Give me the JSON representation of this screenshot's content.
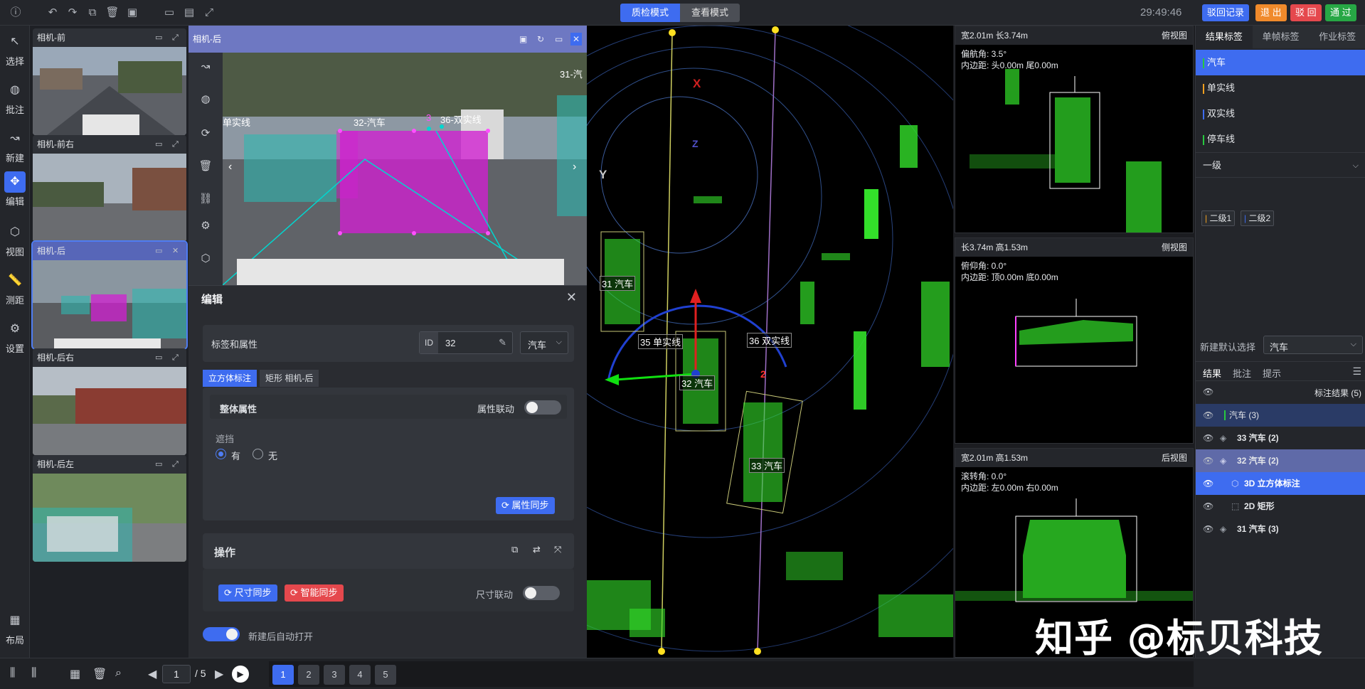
{
  "topbar": {
    "mode_qc": "质检模式",
    "mode_view": "查看模式",
    "clock": "29:49:46",
    "btn_reject_log": "驳回记录",
    "btn_exit": "退 出",
    "btn_reject": "驳 回",
    "btn_pass": "通 过",
    "colors": {
      "accent": "#3e6cf0",
      "orange": "#f08a2b",
      "red": "#e5484d",
      "green": "#27a745"
    }
  },
  "tools": [
    {
      "label": "选择",
      "icon": "cursor-icon"
    },
    {
      "label": "批注",
      "icon": "annotate-icon"
    },
    {
      "label": "新建",
      "icon": "polyline-icon"
    },
    {
      "label": "编辑",
      "icon": "move-icon"
    },
    {
      "label": "视图",
      "icon": "cube-icon"
    },
    {
      "label": "测距",
      "icon": "ruler-icon"
    },
    {
      "label": "设置",
      "icon": "gear-icon"
    },
    {
      "label": "布局",
      "icon": "layout-icon"
    }
  ],
  "cameras": [
    {
      "name": "相机-前"
    },
    {
      "name": "相机-前右"
    },
    {
      "name": "相机-后"
    },
    {
      "name": "相机-后右"
    },
    {
      "name": "相机-后左"
    }
  ],
  "main_camera": {
    "title": "相机-后",
    "labels": {
      "l1": "单实线",
      "l2": "32-汽车",
      "l3": "3",
      "l4": "36-双实线",
      "l5": "31-汽"
    }
  },
  "edit_panel": {
    "title": "编辑",
    "label_attr": "标签和属性",
    "id_label": "ID",
    "id_value": "32",
    "category": "汽车",
    "tab_cuboid": "立方体标注",
    "tab_rect": "矩形 相机-后",
    "whole_attr": "整体属性",
    "attr_link": "属性联动",
    "occlusion": "遮挡",
    "opt_yes": "有",
    "opt_no": "无",
    "attr_sync": "属性同步",
    "operations": "操作",
    "size_sync": "尺寸同步",
    "smart_sync": "智能同步",
    "size_link": "尺寸联动",
    "auto_open": "新建后自动打开"
  },
  "pointcloud": {
    "axis_x": "X",
    "axis_y": "Y",
    "axis_z": "Z",
    "box_31": "31 汽车",
    "box_32": "32 汽车",
    "box_33": "33 汽车",
    "line_35": "35 单实线",
    "line_36": "36 双实线",
    "marker": "2"
  },
  "side_views": {
    "top": {
      "dims": "宽2.01m  长3.74m",
      "title": "俯视图",
      "l1": "偏航角: 3.5°",
      "l2": "内边距: 头0.00m  尾0.00m"
    },
    "side": {
      "dims": "长3.74m  高1.53m",
      "title": "侧视图",
      "l1": "俯仰角: 0.0°",
      "l2": "内边距: 顶0.00m  底0.00m"
    },
    "back": {
      "dims": "宽2.01m  高1.53m",
      "title": "后视图",
      "l1": "滚转角: 0.0°",
      "l2": "内边距: 左0.00m  右0.00m"
    }
  },
  "right_panel": {
    "tabs": [
      "结果标签",
      "单帧标签",
      "作业标签"
    ],
    "labels": [
      {
        "name": "汽车",
        "color": "#27c93f"
      },
      {
        "name": "单实线",
        "color": "#f0a020"
      },
      {
        "name": "双实线",
        "color": "#3e6cf0"
      },
      {
        "name": "停车线",
        "color": "#27c93f"
      }
    ],
    "level1": "一级",
    "chip1": "二级1",
    "chip2": "二级2",
    "default_label": "新建默认选择",
    "default_value": "汽车",
    "result_tabs": [
      "结果",
      "批注",
      "提示"
    ],
    "results_title": "标注结果 (5)",
    "results": [
      {
        "text": "汽车 (3)"
      },
      {
        "text": "33 汽车 (2)"
      },
      {
        "text": "32 汽车 (2)"
      },
      {
        "text": "3D 立方体标注"
      },
      {
        "text": "2D 矩形"
      },
      {
        "text": "31 汽车 (3)"
      }
    ]
  },
  "bottombar": {
    "page_current": "1",
    "page_total": "/ 5",
    "frames": [
      "1",
      "2",
      "3",
      "4",
      "5"
    ]
  },
  "watermark": "知乎 @标贝科技"
}
